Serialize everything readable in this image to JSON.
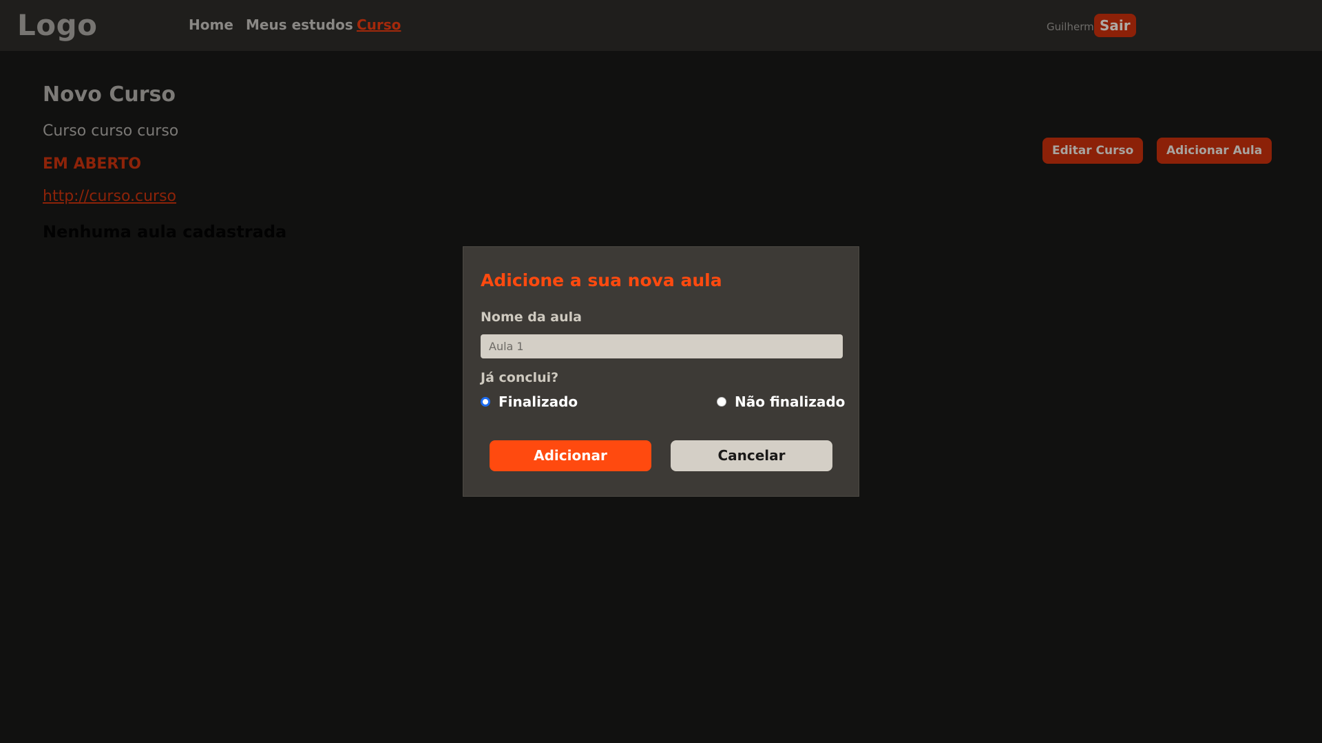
{
  "header": {
    "logo": "Logo",
    "nav": [
      {
        "label": "Home",
        "active": false
      },
      {
        "label": "Meus estudos",
        "active": false
      },
      {
        "label": "Curso",
        "active": true
      }
    ],
    "user_name": "Guilherme",
    "logout_label": "Sair"
  },
  "course": {
    "title": "Novo Curso",
    "description": "Curso curso curso",
    "status": "EM ABERTO",
    "link": "http://curso.curso",
    "empty_message": "Nenhuma aula cadastrada",
    "edit_label": "Editar Curso",
    "add_lesson_label": "Adicionar Aula"
  },
  "modal": {
    "title": "Adicione a sua nova aula",
    "name_label": "Nome da aula",
    "name_placeholder": "Aula 1",
    "name_value": "",
    "done_question": "Já conclui?",
    "options": [
      {
        "label": "Finalizado",
        "checked": true
      },
      {
        "label": "Não finalizado",
        "checked": false
      }
    ],
    "submit_label": "Adicionar",
    "cancel_label": "Cancelar"
  },
  "colors": {
    "accent": "#ff4a0f",
    "accent_dim": "#8d2309",
    "background": "#111110",
    "modal_background": "#3d3a36"
  }
}
